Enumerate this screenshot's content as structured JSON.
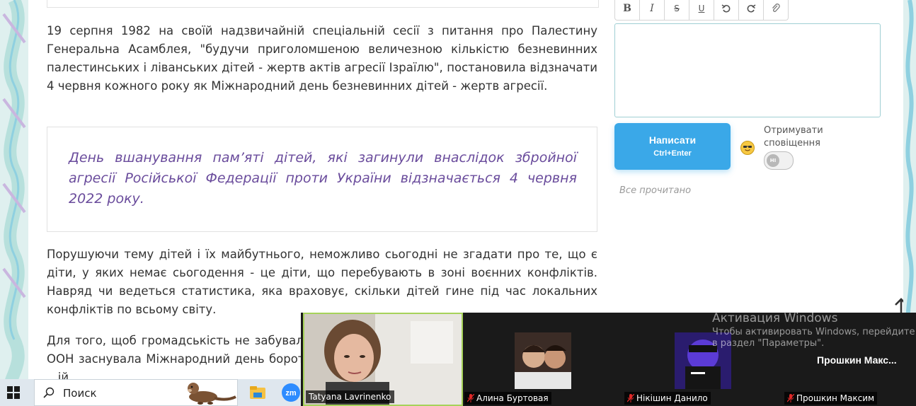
{
  "article": {
    "p1": "19 серпня 1982 на своїй надзвичайній спеціальній сесії з питання про Палестину Генеральна Асамблея, \"будучи приголомшеною величезною кількістю безневинних палестинських і ліванських дітей - жертв актів агресії Ізраїлю\", постановила відзначати 4 червня кожного року як Міжнародний день безневинних дітей - жертв агресії.",
    "quote": "День вшанування пам’яті дітей, які загинули внаслідок збройної агресії Російської Федерації проти України відзначається 4 червня 2022 року.",
    "p2": "Порушуючи тему дітей і їх майбутнього, неможливо сьогодні не згадати про те, що є діти, у яких немає сьогодення - це діти, що перебувають в зоні воєнних конфліктів. Навряд чи ведеться статистика, яка враховує, скільки дітей гине під час локальних конфліктів по всьому світу.",
    "p3": "Для того, щоб громадськість не забувала про дітей, яких використовують як солдати, ООН заснувала Міжнародний день боротьби з використанням дітей-солдатів. А ці... ...ь ...ій..."
  },
  "comment": {
    "toolbar": {
      "bold": "B",
      "italic": "I",
      "strike": "S",
      "underline": "U"
    },
    "editor_value": "",
    "send_label": "Написати",
    "send_hint": "Ctrl+Enter",
    "notify_label": "Отримувати сповіщення",
    "toggle_text": "HI",
    "read_all": "Все прочитано"
  },
  "taskbar": {
    "search_placeholder": "Поиск",
    "apps": [
      "file-explorer",
      "zoom"
    ]
  },
  "zoom": {
    "participants": [
      {
        "name": "Tatyana Lavrinenko",
        "muted": false,
        "active": true
      },
      {
        "name": "Алина Буртовая",
        "muted": true
      },
      {
        "name": "Нікішин Данило",
        "muted": true
      },
      {
        "name": "Прошкин Максим",
        "muted": true,
        "display_name": "Прошкин  Макс..."
      }
    ]
  },
  "windows_activation": {
    "title": "Активация Windows",
    "subtitle": "Чтобы активировать Windows, перейдите в раздел \"Параметры\"."
  },
  "colors": {
    "accent": "#3aa8e8",
    "quote": "#6a4c9c",
    "active_speaker": "#a6d25a"
  }
}
